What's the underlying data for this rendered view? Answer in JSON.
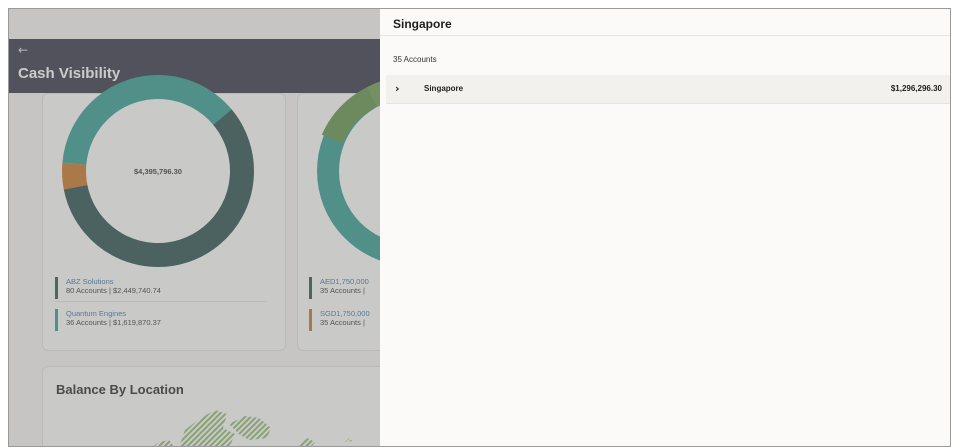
{
  "header": {
    "back_icon": "←",
    "title": "Cash Visibility"
  },
  "cards": {
    "entity_card": {
      "donut_total": "$4,395,796.30",
      "segments": [
        {
          "color": "#244a48",
          "fraction": 0.58
        },
        {
          "color": "#c8721c",
          "fraction": 0.045
        },
        {
          "color": "#2d9a8d",
          "fraction": 0.375
        }
      ],
      "legend": [
        {
          "name": "ABZ Solutions",
          "detail": "80 Accounts | $2,449,740.74",
          "color": "#2c4e4c"
        },
        {
          "name": "Quantum Engines",
          "detail": "36 Accounts | $1,619,870.37",
          "color": "#2d9a8d"
        }
      ]
    },
    "currency_card": {
      "legend": [
        {
          "name": "AED1,750,000",
          "detail": "35 Accounts |",
          "color": "#2c4e4c"
        },
        {
          "name": "SGD1,750,000",
          "detail": "35 Accounts |",
          "color": "#c8721c"
        }
      ]
    },
    "location_card": {
      "title": "Balance By Location"
    }
  },
  "panel": {
    "title": "Singapore",
    "accounts_count": "35 Accounts",
    "rows": [
      {
        "chevron": "›",
        "name": "Singapore",
        "amount": "$1,296,296.30"
      }
    ]
  }
}
